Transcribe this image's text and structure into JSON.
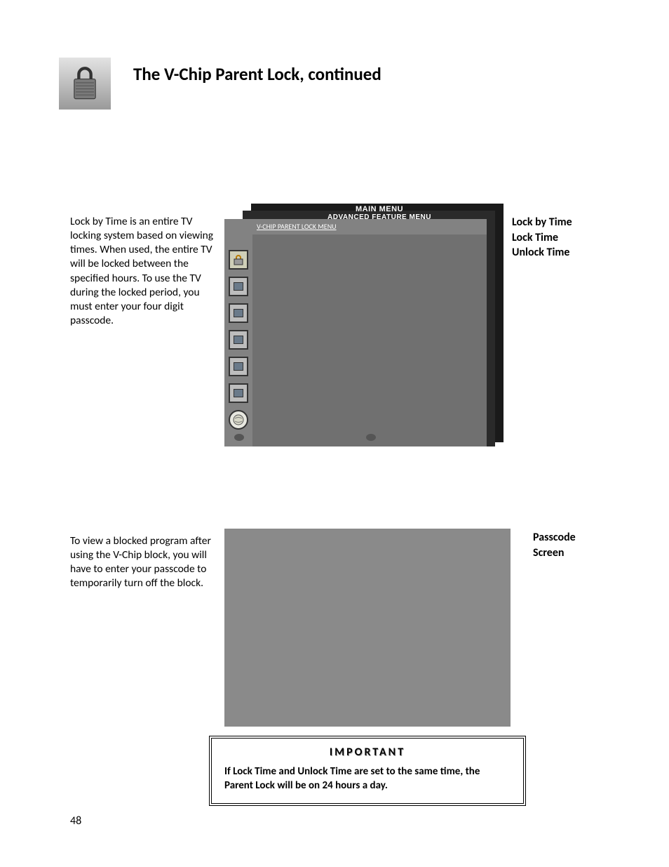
{
  "page": {
    "title": "The  V-Chip Parent Lock, continued",
    "number": "48"
  },
  "left": {
    "p1": "Lock by Time is an entire TV locking system based on viewing times.  When used, the entire TV will be locked between the specified hours. To use the TV during the locked period, you must enter your four digit passcode.",
    "p2": "To view a blocked program after using the V-Chip block, you will have to enter your passcode to temporarily turn off the block."
  },
  "right": {
    "lines": [
      "Lock by Time",
      "Lock Time",
      "Unlock Time"
    ],
    "label2_l1": "Passcode",
    "label2_l2": "Screen"
  },
  "menu": {
    "breadcrumb": [
      "MAIN MENU",
      "ADVANCED FEATURE MENU",
      "V-CHIP PARENT LOCK MENU"
    ]
  },
  "important": {
    "header": "IMPORTANT",
    "body": "If  Lock Time and Unlock Time are set to the same time, the Parent Lock will be on 24 hours a day."
  }
}
